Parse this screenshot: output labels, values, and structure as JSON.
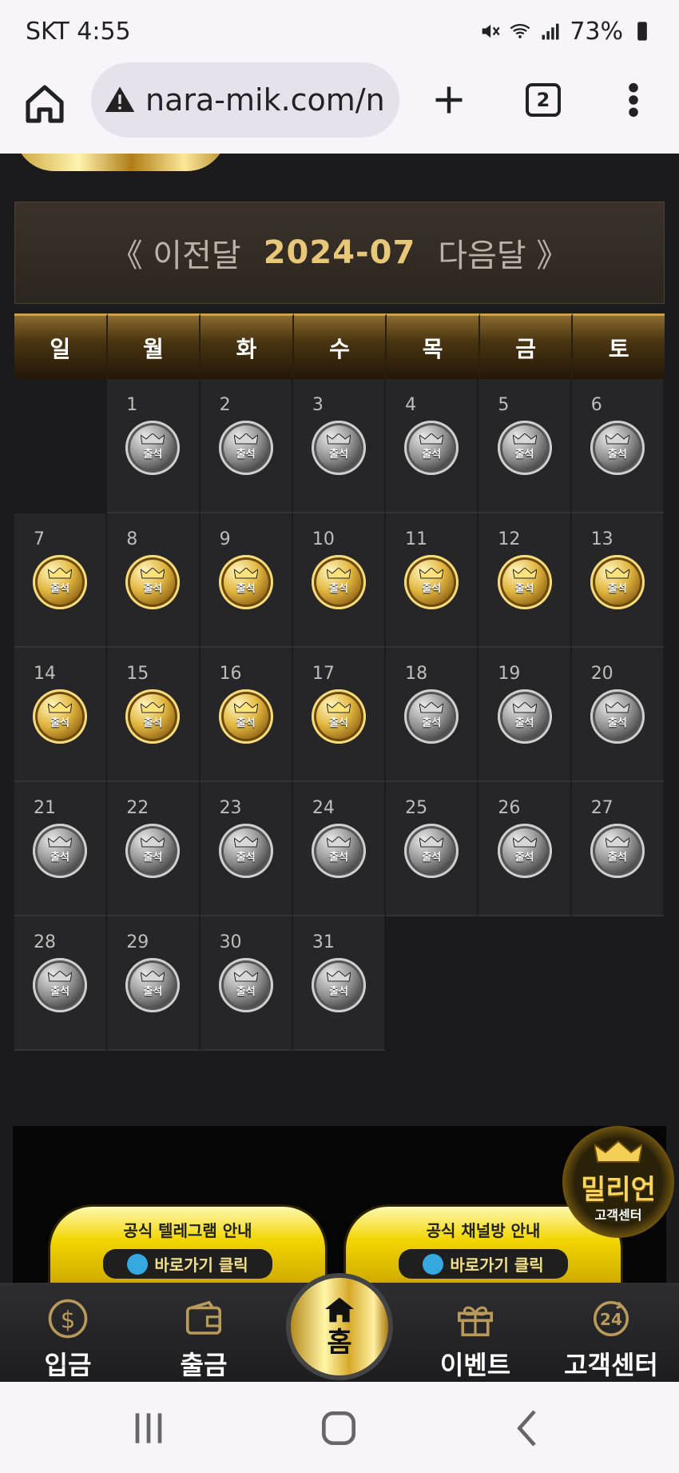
{
  "status": {
    "carrier_time": "SKT 4:55",
    "battery": "73%"
  },
  "browser": {
    "url": "nara-mik.com/n",
    "tab_count": "2"
  },
  "calendar": {
    "prev_label": "《 이전달",
    "month": "2024-07",
    "next_label": "다음달 》",
    "weekdays": [
      "일",
      "월",
      "화",
      "수",
      "목",
      "금",
      "토"
    ],
    "badge_label": "출석",
    "weeks": [
      [
        null,
        {
          "d": "1",
          "s": "silver"
        },
        {
          "d": "2",
          "s": "silver"
        },
        {
          "d": "3",
          "s": "silver"
        },
        {
          "d": "4",
          "s": "silver"
        },
        {
          "d": "5",
          "s": "silver"
        },
        {
          "d": "6",
          "s": "silver"
        }
      ],
      [
        {
          "d": "7",
          "s": "gold"
        },
        {
          "d": "8",
          "s": "gold"
        },
        {
          "d": "9",
          "s": "gold"
        },
        {
          "d": "10",
          "s": "gold"
        },
        {
          "d": "11",
          "s": "gold"
        },
        {
          "d": "12",
          "s": "gold"
        },
        {
          "d": "13",
          "s": "gold"
        }
      ],
      [
        {
          "d": "14",
          "s": "gold"
        },
        {
          "d": "15",
          "s": "gold"
        },
        {
          "d": "16",
          "s": "gold"
        },
        {
          "d": "17",
          "s": "gold"
        },
        {
          "d": "18",
          "s": "silver"
        },
        {
          "d": "19",
          "s": "silver"
        },
        {
          "d": "20",
          "s": "silver"
        }
      ],
      [
        {
          "d": "21",
          "s": "silver"
        },
        {
          "d": "22",
          "s": "silver"
        },
        {
          "d": "23",
          "s": "silver"
        },
        {
          "d": "24",
          "s": "silver"
        },
        {
          "d": "25",
          "s": "silver"
        },
        {
          "d": "26",
          "s": "silver"
        },
        {
          "d": "27",
          "s": "silver"
        }
      ],
      [
        {
          "d": "28",
          "s": "silver"
        },
        {
          "d": "29",
          "s": "silver"
        },
        {
          "d": "30",
          "s": "silver"
        },
        {
          "d": "31",
          "s": "silver"
        },
        null,
        null,
        null
      ]
    ]
  },
  "banner": {
    "telegram": {
      "title": "공식 텔레그램 안내",
      "link": "바로가기 클릭"
    },
    "channel": {
      "title": "공식 채널방 안내",
      "link": "바로가기 클릭"
    },
    "million": {
      "title": "밀리언",
      "sub": "고객센터"
    }
  },
  "bottom_nav": {
    "deposit": "입금",
    "withdraw": "출금",
    "home": "홈",
    "event": "이벤트",
    "support": "고객센터"
  },
  "colors": {
    "gold": "#e8c878",
    "silver": "#9a9a9a",
    "background": "#1b1b1d"
  }
}
